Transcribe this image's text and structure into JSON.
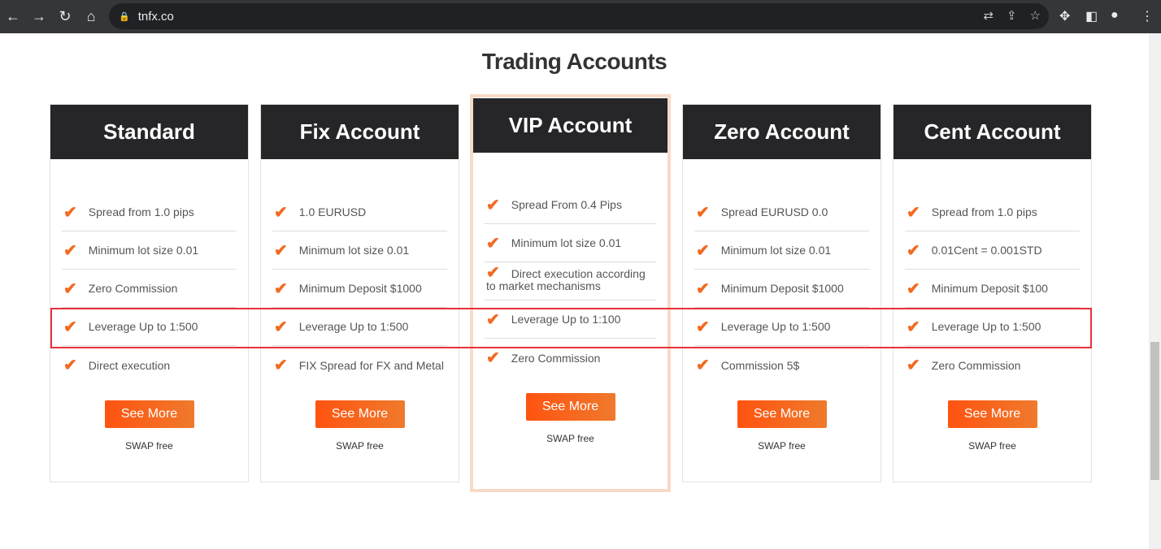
{
  "browser": {
    "url": "tnfx.co",
    "icons": [
      "back-icon",
      "forward-icon",
      "reload-icon",
      "home-icon",
      "lock-icon",
      "translate-icon",
      "share-icon",
      "star-icon",
      "extensions-icon",
      "sidepanel-icon",
      "profile-icon",
      "menu-icon"
    ]
  },
  "page": {
    "title": "Trading Accounts"
  },
  "accent": "#f26a21",
  "cards": [
    {
      "name": "Standard",
      "features": [
        "Spread from 1.0 pips",
        "Minimum lot size 0.01",
        "Zero Commission",
        "Leverage Up to 1:500",
        "Direct execution"
      ],
      "button": "See More",
      "note": "SWAP free"
    },
    {
      "name": "Fix Account",
      "features": [
        "1.0 EURUSD",
        "Minimum lot size 0.01",
        "Minimum Deposit $1000",
        "Leverage Up to 1:500",
        "FIX Spread for FX and Metal"
      ],
      "button": "See More",
      "note": "SWAP free"
    },
    {
      "name": "VIP Account",
      "features": [
        "Spread From 0.4 Pips",
        "Minimum lot size 0.01",
        "Direct execution according to market mechanisms",
        "Leverage Up to 1:100",
        "Zero Commission"
      ],
      "button": "See More",
      "note": "SWAP free"
    },
    {
      "name": "Zero Account",
      "features": [
        "Spread EURUSD 0.0",
        "Minimum lot size 0.01",
        "Minimum Deposit $1000",
        "Leverage Up to 1:500",
        "Commission 5$"
      ],
      "button": "See More",
      "note": "SWAP free"
    },
    {
      "name": "Cent Account",
      "features": [
        "Spread from 1.0 pips",
        "0.01Cent = 0.001STD",
        "Minimum Deposit $100",
        "Leverage Up to 1:500",
        "Zero Commission"
      ],
      "button": "See More",
      "note": "SWAP free"
    }
  ]
}
